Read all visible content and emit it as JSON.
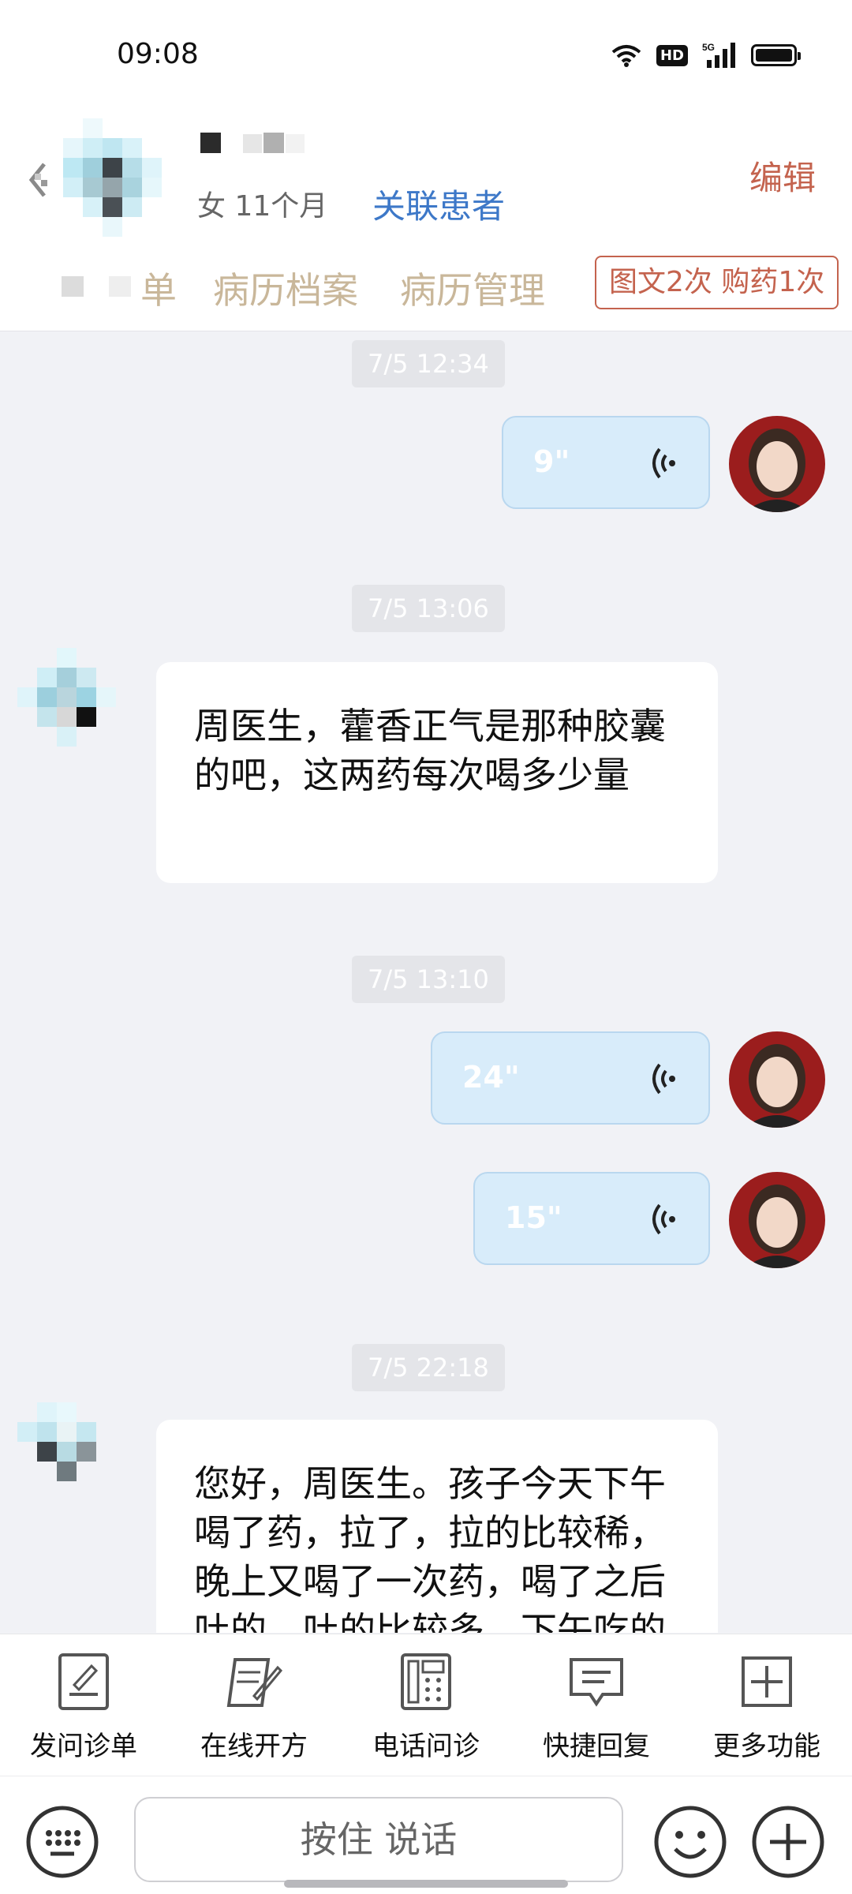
{
  "status_bar": {
    "time": "09:08",
    "icons": [
      "wifi-icon",
      "hd-badge",
      "5g-signal-icon",
      "battery-icon"
    ],
    "hd_label": "HD",
    "network_label": "5G"
  },
  "header": {
    "patient_meta": "女 11个月",
    "related_link": "关联患者",
    "edit_label": "编辑",
    "tabs": [
      "单",
      "病历档案",
      "病历管理"
    ],
    "service_badge": "图文2次 购药1次"
  },
  "messages": {
    "ts1": "7/5 12:34",
    "voice1": "9\"",
    "ts2": "7/5 13:06",
    "text1_line1": "周医生，藿香正气是那种胶囊",
    "text1_line2": "的吧，这两药每次喝多少量",
    "ts3": "7/5 13:10",
    "voice2": "24\"",
    "voice3": "15\"",
    "ts4": "7/5 22:18",
    "text2_line1": "您好，周医生。孩子今天下午",
    "text2_line2": "喝了药，拉了，拉的比较稀，",
    "text2_line3": "晚上又喝了一次药，喝了之后",
    "text2_line4": "吐的，吐的比较多，下午吃的"
  },
  "toolbar": {
    "items": [
      "发问诊单",
      "在线开方",
      "电话问诊",
      "快捷回复",
      "更多功能"
    ]
  },
  "input": {
    "hold_to_talk": "按住 说话"
  },
  "colors": {
    "accent_link": "#3d78c8",
    "edit_red": "#c4634e",
    "tab_gold": "#c9b79a",
    "voice_bubble": "#d8ecfa",
    "chat_bg": "#f1f2f6"
  }
}
